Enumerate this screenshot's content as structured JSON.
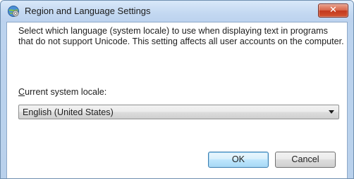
{
  "window": {
    "title": "Region and Language Settings",
    "close_label": "✕"
  },
  "dialog": {
    "description": "Select which language (system locale) to use when displaying text in programs that do not support Unicode. This setting affects all user accounts on the computer.",
    "locale_label_accel": "C",
    "locale_label_rest": "urrent system locale:",
    "selected_locale": "English (United States)"
  },
  "buttons": {
    "ok": "OK",
    "cancel": "Cancel"
  },
  "colors": {
    "titlebar": "#c3d8f1",
    "close_button": "#c3391d",
    "default_button_border": "#3c7fb1"
  },
  "icons": {
    "title": "settings-globe-icon",
    "dropdown": "chevron-down-icon"
  }
}
